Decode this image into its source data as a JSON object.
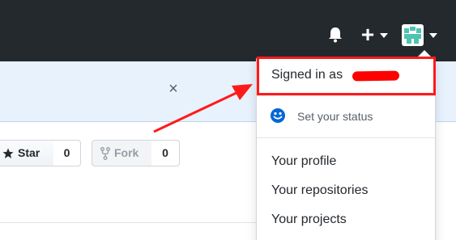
{
  "header": {
    "bell_icon": "bell-icon",
    "plus_icon": "plus-icon",
    "avatar_icon": "avatar-icon"
  },
  "flash": {
    "close_glyph": "×"
  },
  "repo_actions": {
    "star_label": "Star",
    "star_count": "0",
    "fork_label": "Fork",
    "fork_count": "0"
  },
  "dropdown": {
    "signed_in_label": "Signed in as",
    "status_label": "Set your status",
    "items": [
      {
        "label": "Your profile"
      },
      {
        "label": "Your repositories"
      },
      {
        "label": "Your projects"
      }
    ]
  },
  "colors": {
    "header_bg": "#24292e",
    "flash_bg": "#e8f2fd",
    "annotation_red": "#ff1a1a",
    "status_icon_blue": "#0366d6"
  }
}
